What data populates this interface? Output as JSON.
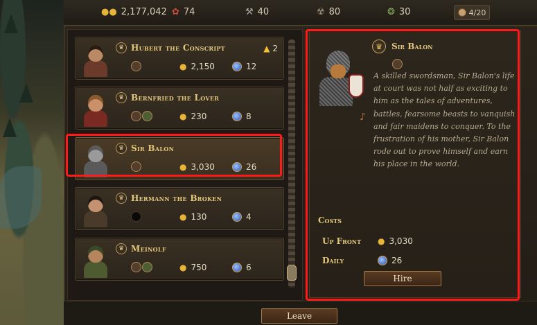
{
  "resources": {
    "gold": "2,177,042",
    "food": "74",
    "tools": "40",
    "medicine": "80",
    "goods": "30",
    "recruits": "4/20"
  },
  "recruits": [
    {
      "name": "Hubert the Conscript",
      "hire_cost": "2,150",
      "daily_cost": "12",
      "rank": "2",
      "traits": [
        "brown"
      ],
      "portrait": {
        "skin": "#b98a63",
        "hair": "#2a1c12",
        "cloth": "#6b3a2a"
      }
    },
    {
      "name": "Bernfried the Lover",
      "hire_cost": "230",
      "daily_cost": "8",
      "traits": [
        "brown",
        "green"
      ],
      "portrait": {
        "skin": "#c9916a",
        "hair": "#8a5a2c",
        "cloth": "#7a2a22"
      }
    },
    {
      "name": "Sir Balon",
      "hire_cost": "3,030",
      "daily_cost": "26",
      "traits": [
        "brown"
      ],
      "portrait": {
        "skin": "#9a9a9a",
        "hair": "#5a5a5a",
        "cloth": "#5a5a5a"
      }
    },
    {
      "name": "Hermann the Broken",
      "hire_cost": "130",
      "daily_cost": "4",
      "traits": [
        "dark"
      ],
      "portrait": {
        "skin": "#c49270",
        "hair": "#1d1510",
        "cloth": "#4a3a2a"
      }
    },
    {
      "name": "Meinolf",
      "hire_cost": "750",
      "daily_cost": "6",
      "traits": [
        "brown",
        "green"
      ],
      "portrait": {
        "skin": "#b5865e",
        "hair": "#3a4a28",
        "cloth": "#4e5a30"
      }
    }
  ],
  "detail": {
    "name": "Sir Balon",
    "description": "A skilled swordsman, Sir Balon's life at court was not half as exciting to him as the tales of adventures, battles, fearsome beasts to vanquish and fair maidens to conquer. To the frustration of his mother, Sir Balon rode out to prove himself and earn his place in the world.",
    "costs_heading": "Costs",
    "up_front_label": "Up Front",
    "up_front_value": "3,030",
    "daily_label": "Daily",
    "daily_value": "26",
    "hire_label": "Hire"
  },
  "leave_label": "Leave",
  "highlight_color": "#ff1a1a"
}
